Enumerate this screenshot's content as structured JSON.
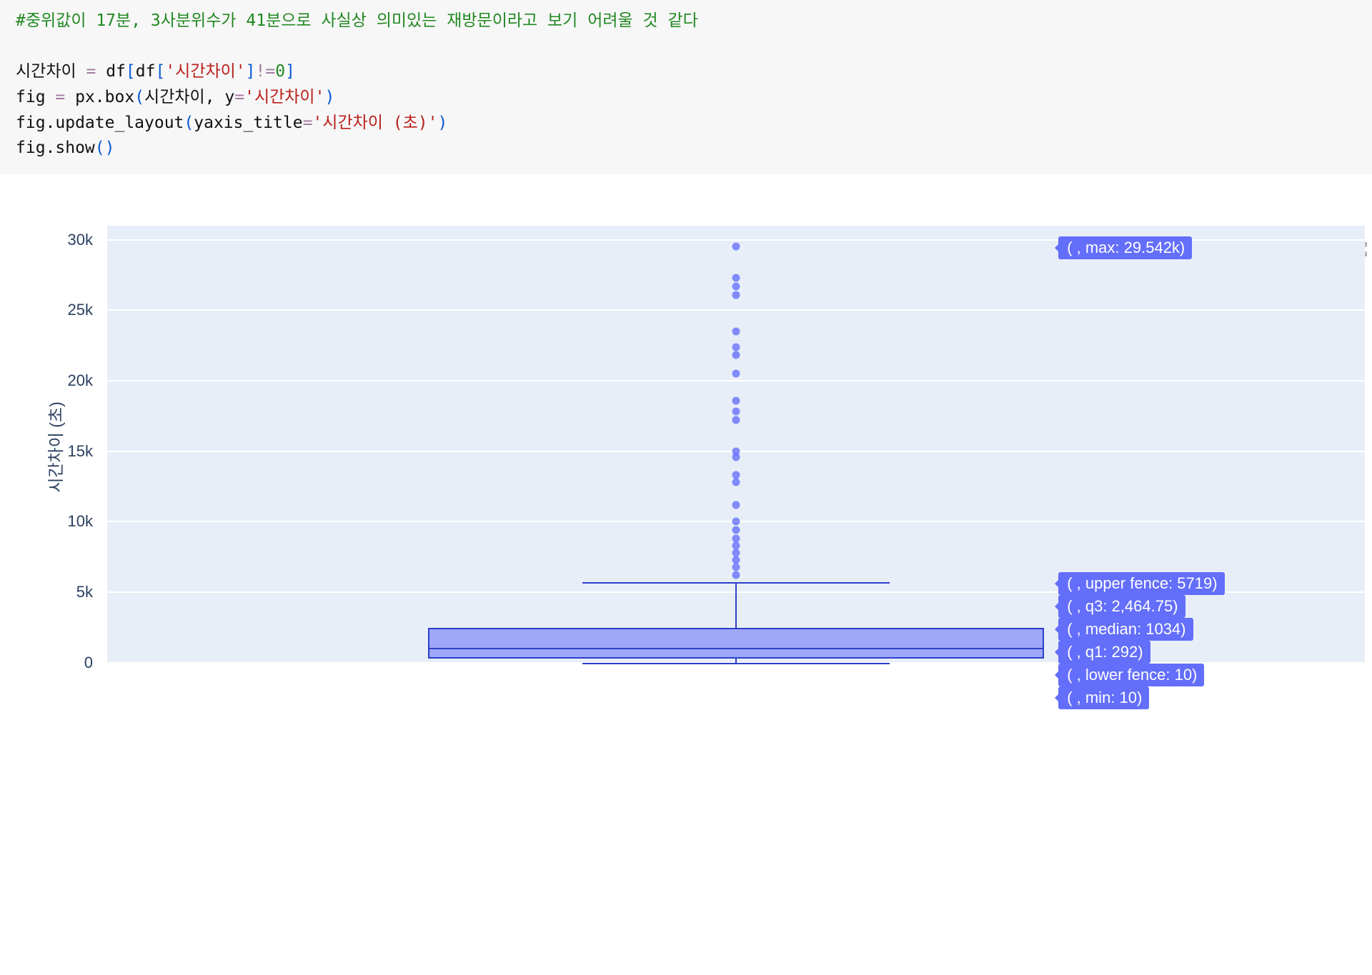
{
  "code": {
    "comment": "#중위값이 17분, 3사분위수가 41분으로 사실상 의미있는 재방문이라고 보기 어려울 것 같다",
    "var_time": "시간차이",
    "eq": " = ",
    "df": "df",
    "col_str": "'시간차이'",
    "neq": "!=",
    "zero": "0",
    "fig": "fig",
    "px_box": "px.box",
    "y_kw": "y",
    "update_layout": "fig.update_layout",
    "yaxis_title_kw": "yaxis_title",
    "yaxis_title_str": "'시간차이 (초)'",
    "show": "fig.show",
    "lparen": "(",
    "rparen": ")",
    "lbrack": "[",
    "rbrack": "]",
    "comma": ", "
  },
  "toolbar": {
    "camera": "download-plot",
    "zoom": "zoom",
    "pan": "pan",
    "zoom_in": "zoom-in",
    "zoom_out": "zoom-out",
    "autoscale": "autoscale"
  },
  "chart_data": {
    "type": "box",
    "ylabel": "시간차이 (초)",
    "ylim": [
      0,
      31000
    ],
    "yticks": [
      {
        "v": 0,
        "label": "0"
      },
      {
        "v": 5000,
        "label": "5k"
      },
      {
        "v": 10000,
        "label": "10k"
      },
      {
        "v": 15000,
        "label": "15k"
      },
      {
        "v": 20000,
        "label": "20k"
      },
      {
        "v": 25000,
        "label": "25k"
      },
      {
        "v": 30000,
        "label": "30k"
      }
    ],
    "box": {
      "min": 10,
      "lower_fence": 10,
      "q1": 292,
      "median": 1034,
      "q3": 2464.75,
      "upper_fence": 5719,
      "max": 29542
    },
    "outliers": [
      6200,
      6800,
      7300,
      7800,
      8300,
      8800,
      9400,
      10000,
      11200,
      12800,
      13300,
      14600,
      15000,
      17200,
      17800,
      18600,
      20500,
      21800,
      22400,
      23500,
      26100,
      26700,
      27300,
      29542
    ],
    "tooltips": [
      {
        "key": "max",
        "label": "( , max: 29.542k)"
      },
      {
        "key": "upper_fence",
        "label": "( , upper fence: 5719)"
      },
      {
        "key": "q3",
        "label": "( , q3: 2,464.75)"
      },
      {
        "key": "median",
        "label": "( , median: 1034)"
      },
      {
        "key": "q1",
        "label": "( , q1: 292)"
      },
      {
        "key": "lower_fence",
        "label": "( , lower fence: 10)"
      },
      {
        "key": "min",
        "label": "( , min: 10)"
      }
    ]
  }
}
